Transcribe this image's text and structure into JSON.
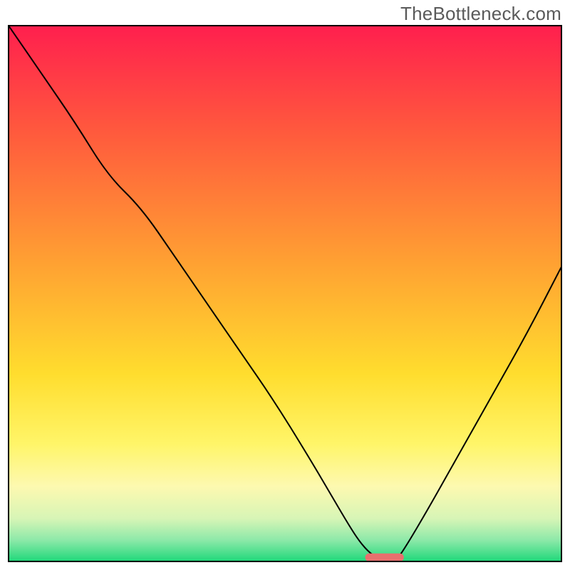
{
  "watermark": "TheBottleneck.com",
  "chart_data": {
    "type": "line",
    "title": "",
    "xlabel": "",
    "ylabel": "",
    "xlim": [
      0,
      100
    ],
    "ylim": [
      0,
      100
    ],
    "legend": null,
    "grid": false,
    "background": {
      "kind": "vertical-gradient",
      "stops": [
        {
          "pos": 0.0,
          "color": "#ff1f4e"
        },
        {
          "pos": 0.2,
          "color": "#ff5a3d"
        },
        {
          "pos": 0.45,
          "color": "#ffa332"
        },
        {
          "pos": 0.65,
          "color": "#ffdd2e"
        },
        {
          "pos": 0.78,
          "color": "#fff568"
        },
        {
          "pos": 0.86,
          "color": "#fdf9b0"
        },
        {
          "pos": 0.92,
          "color": "#d7f5b6"
        },
        {
          "pos": 0.96,
          "color": "#8de9a9"
        },
        {
          "pos": 1.0,
          "color": "#1fd87a"
        }
      ]
    },
    "series": [
      {
        "name": "bottleneck-curve",
        "color": "#000000",
        "stroke_width": 2,
        "x": [
          0,
          6,
          12,
          18,
          24,
          30,
          36,
          42,
          48,
          54,
          58,
          62,
          64,
          66,
          68,
          70,
          72,
          76,
          82,
          88,
          94,
          100
        ],
        "values": [
          100,
          91,
          82,
          72,
          66,
          57,
          48,
          39,
          30,
          20,
          13,
          6,
          3,
          1,
          0,
          0,
          3,
          10,
          21,
          32,
          43,
          55
        ]
      }
    ],
    "marker": {
      "name": "optimal-point",
      "shape": "rounded-bar",
      "color": "#e8706e",
      "x_center": 68,
      "y": 0,
      "width_x_units": 7,
      "height_y_units": 1.5
    }
  },
  "colors": {
    "curve": "#000000",
    "marker": "#e8706e",
    "watermark": "#5a5a5a",
    "frame": "#000000"
  }
}
